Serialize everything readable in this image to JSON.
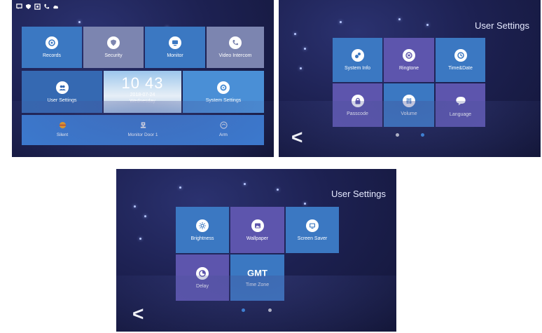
{
  "panel1": {
    "tiles": {
      "records": "Records",
      "security": "Security",
      "monitor": "Monitor",
      "video_intercom": "Video Intercom",
      "user_settings": "User Settings",
      "system_settings": "System Settings"
    },
    "clock": {
      "time": "10 43",
      "date": "2018-07-24",
      "weekday": "Wednesday"
    },
    "bottom": {
      "silent": "Silent",
      "monitor_door": "Monitor Door 1",
      "arm": "Arm"
    }
  },
  "panel2": {
    "title": "User Settings",
    "back": "<",
    "tiles": {
      "system_info": "System Info",
      "ringtone": "Ringtone",
      "time_date": "Time&Date",
      "passcode": "Passcode",
      "volume": "Volume",
      "language": "Language"
    }
  },
  "panel3": {
    "title": "User Settings",
    "back": "<",
    "tiles": {
      "brightness": "Brightness",
      "wallpaper": "Wallpaper",
      "screen_saver": "Screen Saver",
      "delay": "Delay",
      "gmt_glyph": "GMT",
      "time_zone": "Time Zone"
    }
  },
  "colors": {
    "tile_blue": "#3b78c2",
    "tile_purple": "#5d55ad",
    "tile_grayblue": "#7c85b0",
    "bar_blue": "#3b7bd0",
    "dot_active": "#3d8be0",
    "dot_inactive": "#c8c8d0"
  }
}
